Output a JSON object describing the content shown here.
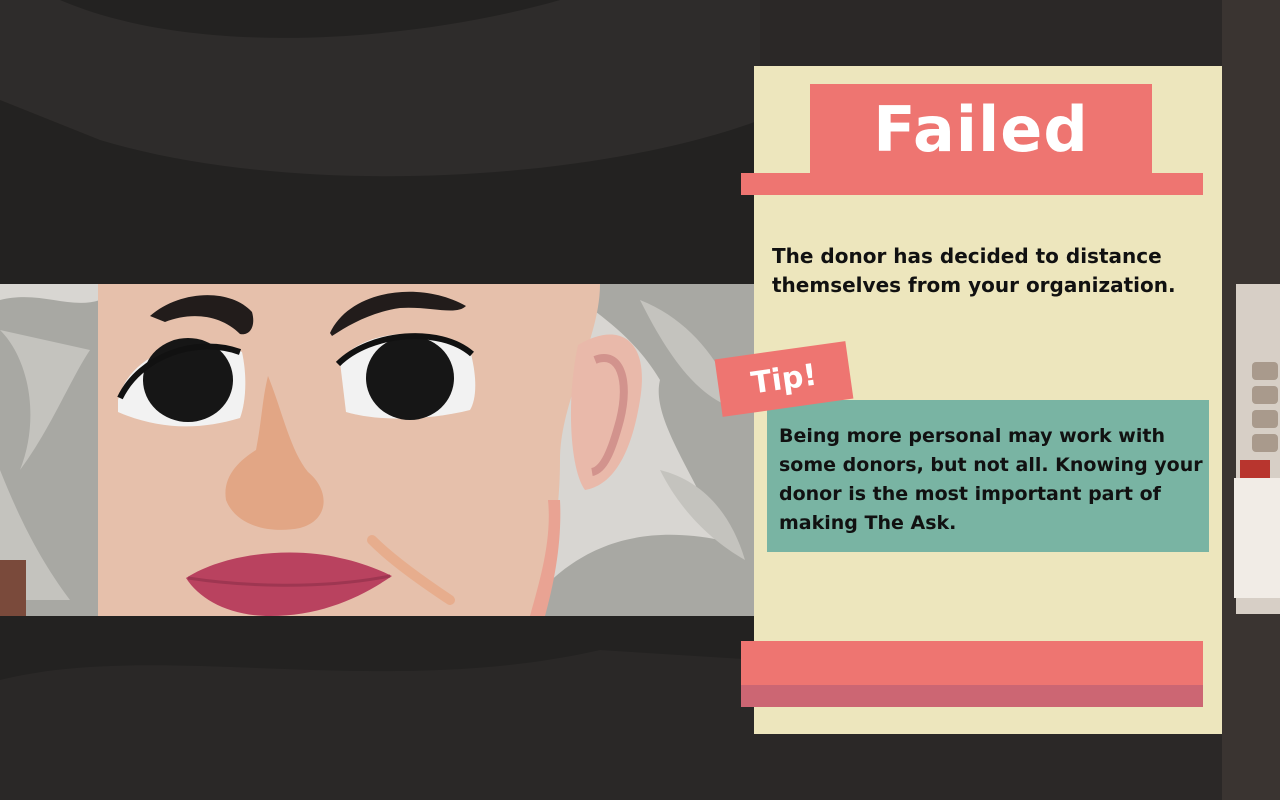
{
  "result_card": {
    "title": "Failed",
    "message": "The donor has decided to distance themselves from your organization.",
    "tip_label": "Tip!",
    "tip_text": "Being more personal may work with some donors, but not all. Knowing your donor is the most important part of making The Ask.",
    "colors": {
      "card": "#ede6bd",
      "banner": "#ee7571",
      "tip_box": "#79b4a3",
      "button_shadow": "#cc6673"
    }
  },
  "scene": {
    "character": "donor-portrait",
    "colors": {
      "skin": "#e6c0ab",
      "hair": "#a7a7a2",
      "lips": "#b9425f",
      "nose": "#e2a685",
      "letterbox": "#232221"
    }
  }
}
